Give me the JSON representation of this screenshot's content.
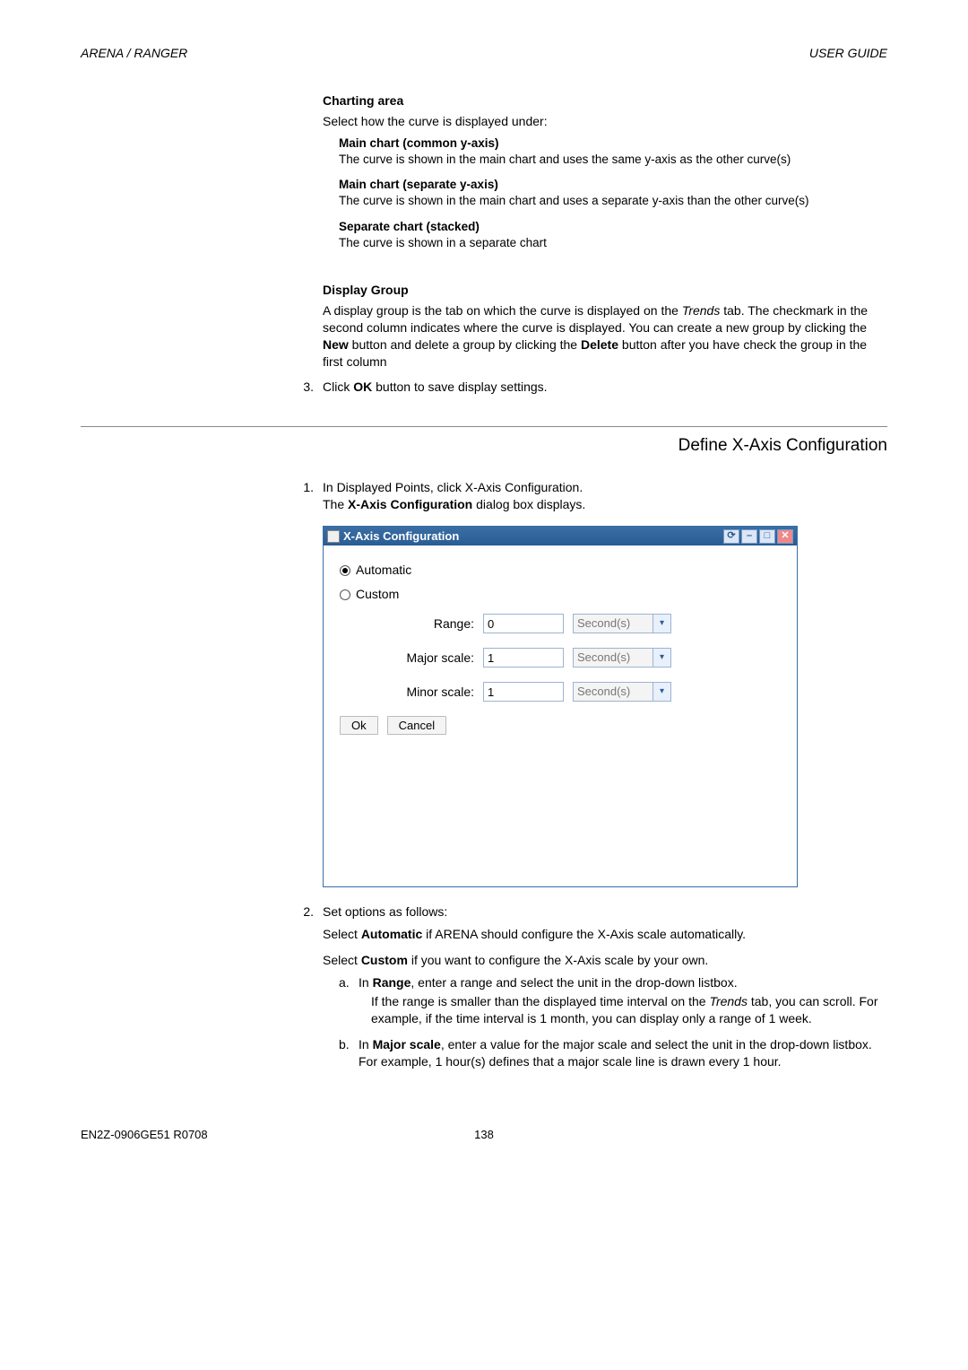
{
  "header": {
    "left": "ARENA / RANGER",
    "right": "USER GUIDE"
  },
  "charting": {
    "title": "Charting area",
    "intro": "Select how the curve is displayed under:",
    "options": [
      {
        "name": "Main chart (common y-axis)",
        "desc": "The curve is shown in the main chart and uses the same y-axis as the other curve(s)"
      },
      {
        "name": "Main chart (separate y-axis)",
        "desc": "The curve is shown in the main chart and uses a separate y-axis than the other curve(s)"
      },
      {
        "name": "Separate chart (stacked)",
        "desc": "The curve is shown in a separate chart"
      }
    ]
  },
  "display_group": {
    "title": "Display Group",
    "para_pre": "A display group is the tab on which the curve is displayed on the ",
    "para_trends": "Trends",
    "para_mid": " tab. The checkmark in the second column indicates where the curve is displayed. You can create a new group by clicking the ",
    "para_new": "New",
    "para_mid2": " button and delete a group by clicking the ",
    "para_delete": "Delete",
    "para_end": " button after you have check the group in the first column"
  },
  "step3": {
    "num": "3.",
    "pre": "Click ",
    "ok": "OK",
    "post": " button to save display settings."
  },
  "section_heading": "Define X-Axis Configuration",
  "step1": {
    "num": "1.",
    "line1": "In Displayed Points, click X-Axis Configuration.",
    "line2_pre": "The ",
    "line2_bold": "X-Axis Configuration",
    "line2_post": " dialog box displays."
  },
  "dialog": {
    "title": "X-Axis Configuration",
    "radio_auto": "Automatic",
    "radio_custom": "Custom",
    "fields": {
      "range_label": "Range:",
      "range_value": "0",
      "major_label": "Major scale:",
      "major_value": "1",
      "minor_label": "Minor scale:",
      "minor_value": "1",
      "unit": "Second(s)"
    },
    "ok": "Ok",
    "cancel": "Cancel"
  },
  "step2": {
    "num": "2.",
    "intro": "Set options as follows:",
    "auto_pre": "Select ",
    "auto_bold": "Automatic",
    "auto_post": " if ARENA should configure the X-Axis scale automatically.",
    "custom_pre": "Select ",
    "custom_bold": "Custom",
    "custom_post": " if you want to configure the X-Axis scale by your own.",
    "a": {
      "letter": "a.",
      "pre": "In ",
      "bold": "Range",
      "post": ", enter a range and select the unit in the drop-down listbox.",
      "detail_pre": "If the range is smaller than the displayed time interval on the ",
      "detail_it": "Trends",
      "detail_post": " tab, you can scroll. For example, if the time interval is 1 month, you can display only a range of 1 week."
    },
    "b": {
      "letter": "b.",
      "pre": "In ",
      "bold": "Major scale",
      "post": ", enter a value for the major scale and select the unit in the drop-down listbox. For example, 1 hour(s) defines that a major scale line is drawn every 1 hour."
    }
  },
  "footer": {
    "left": "EN2Z-0906GE51 R0708",
    "page": "138"
  }
}
